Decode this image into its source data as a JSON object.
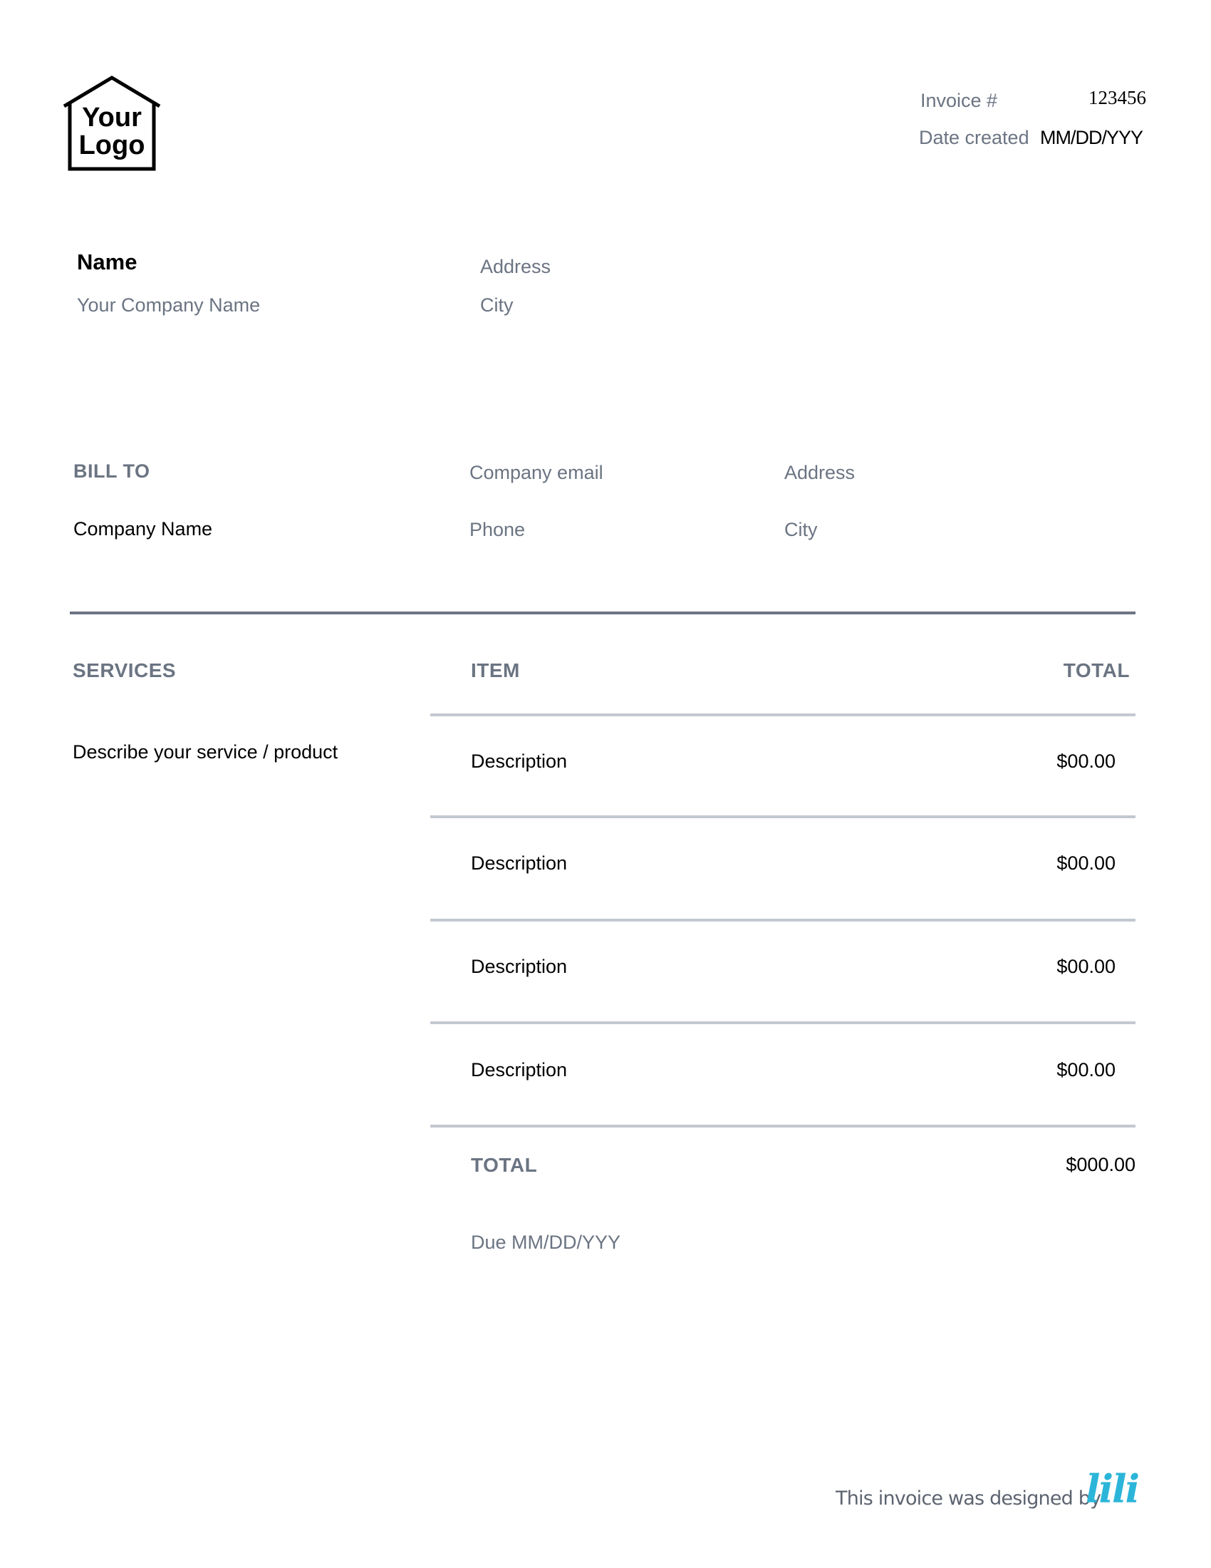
{
  "logo": {
    "line1": "Your",
    "line2": "Logo"
  },
  "invoice_meta": {
    "invoice_label": "Invoice #",
    "invoice_number": "123456",
    "date_label": "Date created",
    "date_value": "MM/DD/YYY"
  },
  "sender": {
    "name": "Name",
    "company": "Your Company Name",
    "address": "Address",
    "city": "City"
  },
  "bill_to": {
    "label": "BILL TO",
    "company": "Company Name",
    "email": "Company email",
    "phone": "Phone",
    "address": "Address",
    "city": "City"
  },
  "services": {
    "section_label": "SERVICES",
    "item_header": "ITEM",
    "total_header": "TOTAL",
    "service_description": "Describe your service / product",
    "rows": [
      {
        "description": "Description",
        "amount": "$00.00"
      },
      {
        "description": "Description",
        "amount": "$00.00"
      },
      {
        "description": "Description",
        "amount": "$00.00"
      },
      {
        "description": "Description",
        "amount": "$00.00"
      }
    ],
    "total_label": "TOTAL",
    "total_value": "$000.00",
    "due": "Due MM/DD/YYY"
  },
  "footer": {
    "credit": "This invoice was designed by",
    "brand": "lili",
    "brand_color": "#2bb5d8"
  },
  "colors": {
    "muted_text": "#6b7482",
    "divider_dark": "#6b7482",
    "divider_light": "#c3c8d0"
  }
}
